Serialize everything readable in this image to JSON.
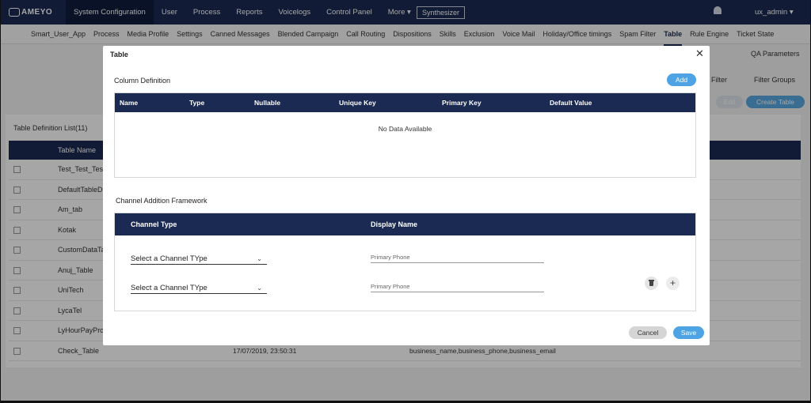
{
  "topbar": {
    "logo_text": "AMEYO",
    "nav": [
      {
        "label": "System Configuration"
      },
      {
        "label": "User"
      },
      {
        "label": "Process"
      },
      {
        "label": "Reports"
      },
      {
        "label": "Voicelogs"
      },
      {
        "label": "Control Panel"
      },
      {
        "label": "More ▾"
      }
    ],
    "synth_label": "Synthesizer",
    "user_label": "ux_admin ▾"
  },
  "subnav": {
    "items": [
      {
        "label": "Smart_User_App"
      },
      {
        "label": "Process"
      },
      {
        "label": "Media Profile"
      },
      {
        "label": "Settings"
      },
      {
        "label": "Canned Messages"
      },
      {
        "label": "Blended Campaign"
      },
      {
        "label": "Call Routing"
      },
      {
        "label": "Dispositions"
      },
      {
        "label": "Skills"
      },
      {
        "label": "Exclusion"
      },
      {
        "label": "Voice Mail"
      },
      {
        "label": "Holiday/Office timings"
      },
      {
        "label": "Spam Filter"
      },
      {
        "label": "Table"
      },
      {
        "label": "Rule Engine"
      },
      {
        "label": "Ticket State"
      }
    ],
    "qa_label": "QA Parameters"
  },
  "background": {
    "filter_label": "Filter",
    "filter_groups_label": "Filter Groups",
    "edit_label": "Edit",
    "create_label": "Create Table",
    "list_title": "Table Definition List(11)",
    "col_name": "Table Name",
    "rows": [
      {
        "name": "Test_Test_Tes",
        "date": "",
        "fields": ""
      },
      {
        "name": "DefaultTableD",
        "date": "",
        "fields": ""
      },
      {
        "name": "Am_tab",
        "date": "",
        "fields": ""
      },
      {
        "name": "Kotak",
        "date": "",
        "fields": ""
      },
      {
        "name": "CustomDataTa",
        "date": "",
        "fields": ""
      },
      {
        "name": "Anuj_Table",
        "date": "",
        "fields": ""
      },
      {
        "name": "UniTech",
        "date": "",
        "fields": ""
      },
      {
        "name": "LycaTel",
        "date": "",
        "fields": ""
      },
      {
        "name": "LyHourPayPro",
        "date": "",
        "fields": ""
      },
      {
        "name": "Check_Table",
        "date": "17/07/2019, 23:50:31",
        "fields": "business_name,business_phone,business_email"
      }
    ]
  },
  "modal": {
    "title": "Table",
    "close_glyph": "✕",
    "column_def_label": "Column Definition",
    "add_label": "Add",
    "columns": [
      "Name",
      "Type",
      "Nullable",
      "Unique Key",
      "Primary Key",
      "Default Value"
    ],
    "no_data": "No Data Available",
    "channel_label": "Channel Addition Framework",
    "channel_cols": [
      "Channel Type",
      "Display Name"
    ],
    "channel_rows": [
      {
        "select_value": "Select a Channel TYpe",
        "placeholder": "Primary Phone"
      },
      {
        "select_value": "Select a Channel TYpe",
        "placeholder": "Primary Phone"
      }
    ],
    "cancel_label": "Cancel",
    "save_label": "Save"
  }
}
